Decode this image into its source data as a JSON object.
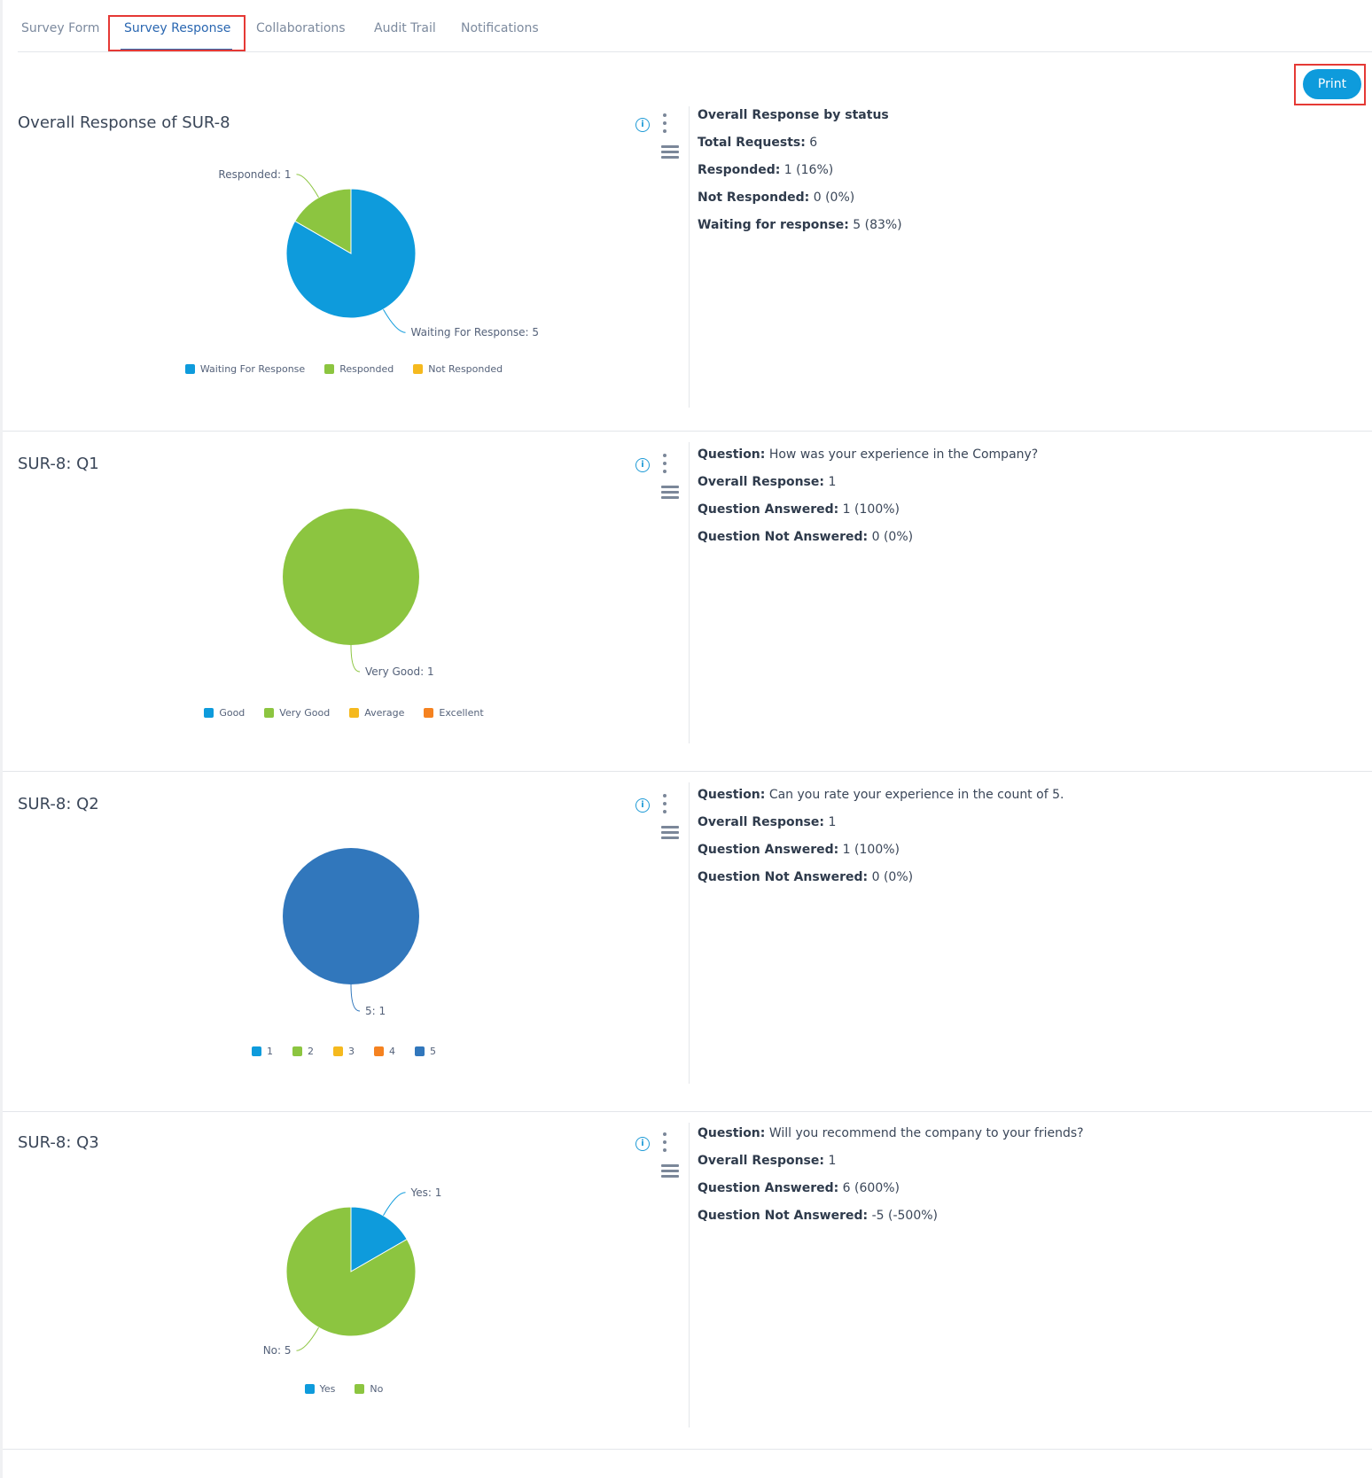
{
  "tabs": [
    {
      "label": "Survey Form",
      "active": false
    },
    {
      "label": "Survey Response",
      "active": true
    },
    {
      "label": "Collaborations",
      "active": false
    },
    {
      "label": "Audit Trail",
      "active": false
    },
    {
      "label": "Notifications",
      "active": false
    }
  ],
  "toolbar": {
    "print_label": "Print"
  },
  "colors": {
    "blue": "#0e9bdc",
    "green": "#8cc540",
    "yellow": "#f5b91e",
    "orange": "#f58220",
    "darkblue": "#3177bc",
    "accent": "#2a67b1",
    "highlight": "#e53935"
  },
  "sections": [
    {
      "title": "Overall Response of SUR-8",
      "info": [
        {
          "label": "Overall Response by status",
          "value": ""
        },
        {
          "label": "Total Requests:",
          "value": " 6"
        },
        {
          "label": "Responded:",
          "value": " 1 (16%)"
        },
        {
          "label": "Not Responded:",
          "value": " 0 (0%)"
        },
        {
          "label": "Waiting for response:",
          "value": " 5 (83%)"
        }
      ]
    },
    {
      "title": "SUR-8: Q1",
      "info": [
        {
          "label": "Question:",
          "value": " How was your experience in the Company?"
        },
        {
          "label": "Overall Response:",
          "value": " 1"
        },
        {
          "label": "Question Answered:",
          "value": " 1 (100%)"
        },
        {
          "label": "Question Not Answered:",
          "value": " 0 (0%)"
        }
      ]
    },
    {
      "title": "SUR-8: Q2",
      "info": [
        {
          "label": "Question:",
          "value": " Can you rate your experience in the count of 5."
        },
        {
          "label": "Overall Response:",
          "value": " 1"
        },
        {
          "label": "Question Answered:",
          "value": " 1 (100%)"
        },
        {
          "label": "Question Not Answered:",
          "value": " 0 (0%)"
        }
      ]
    },
    {
      "title": "SUR-8: Q3",
      "info": [
        {
          "label": "Question:",
          "value": " Will you recommend the company to your friends?"
        },
        {
          "label": "Overall Response:",
          "value": " 1"
        },
        {
          "label": "Question Answered:",
          "value": " 6 (600%)"
        },
        {
          "label": "Question Not Answered:",
          "value": " -5 (-500%)"
        }
      ]
    }
  ],
  "chart_data": [
    {
      "type": "pie",
      "title": "Overall Response of SUR-8",
      "categories": [
        "Waiting For Response",
        "Responded",
        "Not Responded"
      ],
      "values": [
        5,
        1,
        0
      ],
      "colors": [
        "#0e9bdc",
        "#8cc540",
        "#f5b91e"
      ],
      "data_labels": [
        "Waiting For Response: 5",
        "Responded: 1",
        ""
      ],
      "legend": "bottom"
    },
    {
      "type": "pie",
      "title": "SUR-8: Q1",
      "categories": [
        "Good",
        "Very Good",
        "Average",
        "Excellent"
      ],
      "values": [
        0,
        1,
        0,
        0
      ],
      "colors": [
        "#0e9bdc",
        "#8cc540",
        "#f5b91e",
        "#f58220"
      ],
      "data_labels": [
        "",
        "Very Good: 1",
        "",
        ""
      ],
      "legend": "bottom"
    },
    {
      "type": "pie",
      "title": "SUR-8: Q2",
      "categories": [
        "1",
        "2",
        "3",
        "4",
        "5"
      ],
      "values": [
        0,
        0,
        0,
        0,
        1
      ],
      "colors": [
        "#0e9bdc",
        "#8cc540",
        "#f5b91e",
        "#f58220",
        "#3177bc"
      ],
      "data_labels": [
        "",
        "",
        "",
        "",
        "5: 1"
      ],
      "legend": "bottom"
    },
    {
      "type": "pie",
      "title": "SUR-8: Q3",
      "categories": [
        "Yes",
        "No"
      ],
      "values": [
        1,
        5
      ],
      "colors": [
        "#0e9bdc",
        "#8cc540"
      ],
      "data_labels": [
        "Yes: 1",
        "No: 5"
      ],
      "legend": "bottom"
    }
  ]
}
